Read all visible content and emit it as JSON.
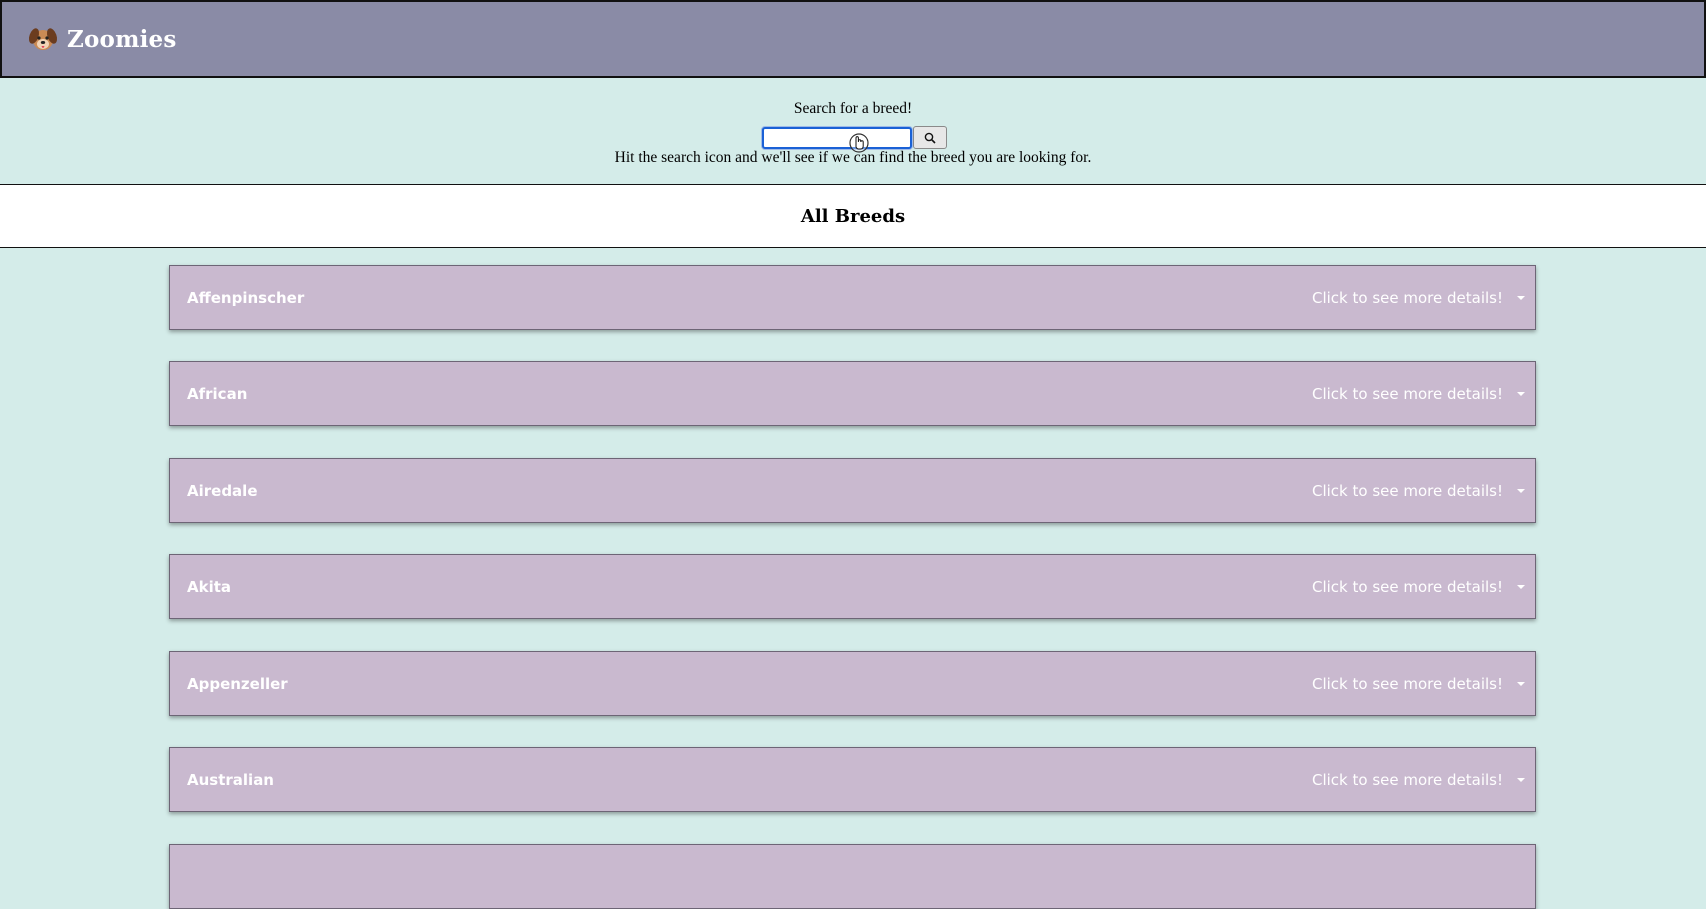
{
  "header": {
    "title": "Zoomies",
    "logo_icon": "dog-face-icon"
  },
  "search": {
    "prompt": "Search for a breed!",
    "value": "",
    "hint": "Hit the search icon and we'll see if we can find the breed you are looking for.",
    "button_icon": "magnifier-icon"
  },
  "section": {
    "title": "All Breeds"
  },
  "breeds": [
    {
      "name": "Affenpinscher",
      "hint": "Click to see more details!"
    },
    {
      "name": "African",
      "hint": "Click to see more details!"
    },
    {
      "name": "Airedale",
      "hint": "Click to see more details!"
    },
    {
      "name": "Akita",
      "hint": "Click to see more details!"
    },
    {
      "name": "Appenzeller",
      "hint": "Click to see more details!"
    },
    {
      "name": "Australian",
      "hint": "Click to see more details!"
    },
    {
      "name": "",
      "hint": ""
    }
  ],
  "colors": {
    "header_bg": "#8a8ba6",
    "page_bg": "#d4ece9",
    "card_bg": "#c9b9cf",
    "card_text": "#ffffff",
    "focus_ring": "#1a61d6"
  }
}
